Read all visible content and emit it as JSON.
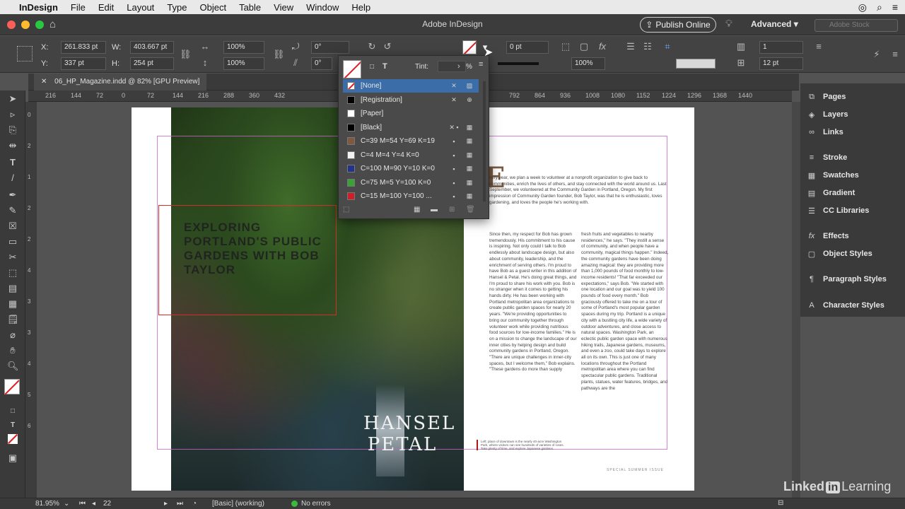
{
  "menubar": {
    "apple": "",
    "app": "InDesign",
    "items": [
      "File",
      "Edit",
      "Layout",
      "Type",
      "Object",
      "Table",
      "View",
      "Window",
      "Help"
    ]
  },
  "titlebar": {
    "title": "Adobe InDesign",
    "publish": "Publish Online",
    "workspace": "Advanced",
    "search_placeholder": "Adobe Stock"
  },
  "control": {
    "x_label": "X:",
    "x": "261.833 pt",
    "y_label": "Y:",
    "y": "337 pt",
    "w_label": "W:",
    "w": "403.667 pt",
    "h_label": "H:",
    "h": "254 pt",
    "scale_x": "100%",
    "scale_y": "100%",
    "rotate": "0°",
    "shear": "0°",
    "stroke_weight": "0 pt",
    "opacity": "100%",
    "columns": "1",
    "gutter": "12 pt"
  },
  "doc_tab": "06_HP_Magazine.indd @ 82% [GPU Preview]",
  "ruler_h": [
    "216",
    "144",
    "72",
    "0",
    "72",
    "144",
    "216",
    "288",
    "360",
    "432",
    "792",
    "864",
    "936",
    "1008",
    "1080",
    "1152",
    "1224",
    "1296",
    "1368",
    "1440"
  ],
  "ruler_v": [
    "0",
    "2",
    "1",
    "2",
    "2",
    "4",
    "3",
    "3",
    "4",
    "5",
    "6"
  ],
  "swatches_popup": {
    "tint_label": "Tint:",
    "tint_unit": "%",
    "items": [
      {
        "name": "[None]",
        "color": "none",
        "selected": true
      },
      {
        "name": "[Registration]",
        "color": "#000000"
      },
      {
        "name": "[Paper]",
        "color": "#ffffff"
      },
      {
        "name": "[Black]",
        "color": "#000000"
      },
      {
        "name": "C=39 M=54 Y=69 K=19",
        "color": "#7d5a3f"
      },
      {
        "name": "C=4 M=4 Y=4 K=0",
        "color": "#f2f2f2"
      },
      {
        "name": "C=100 M=90 Y=10 K=0",
        "color": "#23338a"
      },
      {
        "name": "C=75 M=5 Y=100 K=0",
        "color": "#3aa136"
      },
      {
        "name": "C=15 M=100 Y=100 ...",
        "color": "#cc1f2a"
      }
    ]
  },
  "document": {
    "headline": "EXPLORING PORTLAND'S PUBLIC GARDENS WITH BOB TAYLOR",
    "logo_line1": "HANSEL",
    "logo_line2": "PETAL",
    "dropcap": "E",
    "intro": "very year, we plan a week to volunteer at a nonprofit organization to give back to communities, enrich the lives of others, and stay connected with the world around us. Last September, we volunteered at the Community Garden in Portland, Oregon. My first impression of Community Garden founder, Bob Taylor, was that he is enthusiastic, loves gardening, and loves the people he's working with.",
    "col1": "Since then, my respect for Bob has grown tremendously. His commitment to his cause is inspiring. Not only could I talk to Bob endlessly about landscape design, but also about community, leadership, and the enrichment of serving others. I'm proud to have Bob as a guest writer in this addition of Hansel & Petal. He's doing great things, and I'm proud to share his work with you. Bob is no stranger when it comes to getting his hands dirty. He has been working with Portland metropolitan area organizations to create public garden spaces for nearly 20 years. \"We're providing opportunities to bring our community together through volunteer work while providing nutritious food sources for low-income families.\" He is on a mission to change the landscape of our inner cities by helping design and build community gardens in Portland, Oregon. \"There are unique challenges in inner-city spaces, but I welcome them,\" Bob explains. \"These gardens do more than supply",
    "col2": "fresh fruits and vegetables to nearby residences,\" he says. \"They instill a sense of community, and when people have a community, magical things happen.\" Indeed, the community gardens have been doing amazing magical: they are providing more than 1,000 pounds of food monthly to low-income residents! \"That far exceeded our expectations,\" says Bob. \"We started with one location and our goal was to yield 100 pounds of food every month.\" Bob graciously offered to take me on a tour of some of Portland's most popular garden spaces during my trip. Portland is a unique city with a bustling city life, a wide variety of outdoor adventures, and close access to natural spaces. Washington Park, an eclectic public garden space with numerous hiking trails, Japanese gardens, museums, and even a zoo, could take days to explore all on its own. This is just one of many locations throughout the Portland metropolitan area where you can find spectacular public gardens. Traditional plants, statues, water features, bridges, and pathways are the",
    "caption": "Left: place of downtown is the nearly 40-acre Washington Park, where visitors can see hundreds of varieties of roses. Take plenty of time, and explore Japanese gardens.",
    "footer": "SPECIAL SUMMER ISSUE"
  },
  "panels": [
    {
      "icon": "pages",
      "label": "Pages"
    },
    {
      "icon": "layers",
      "label": "Layers"
    },
    {
      "icon": "links",
      "label": "Links"
    },
    {
      "icon": "stroke",
      "label": "Stroke"
    },
    {
      "icon": "swatches",
      "label": "Swatches"
    },
    {
      "icon": "gradient",
      "label": "Gradient"
    },
    {
      "icon": "cc-libraries",
      "label": "CC Libraries"
    },
    {
      "icon": "effects",
      "label": "Effects"
    },
    {
      "icon": "object-styles",
      "label": "Object Styles"
    },
    {
      "icon": "paragraph-styles",
      "label": "Paragraph Styles"
    },
    {
      "icon": "character-styles",
      "label": "Character Styles"
    }
  ],
  "status": {
    "zoom": "81.95%",
    "page": "22",
    "style": "[Basic] (working)",
    "errors": "No errors"
  },
  "watermark": {
    "left": "Linked",
    "in": "in",
    "right": "Learning"
  },
  "colors": {
    "selection": "#3b6ea8",
    "guide": "#c765c9",
    "accent_brown": "#7a5a40"
  }
}
